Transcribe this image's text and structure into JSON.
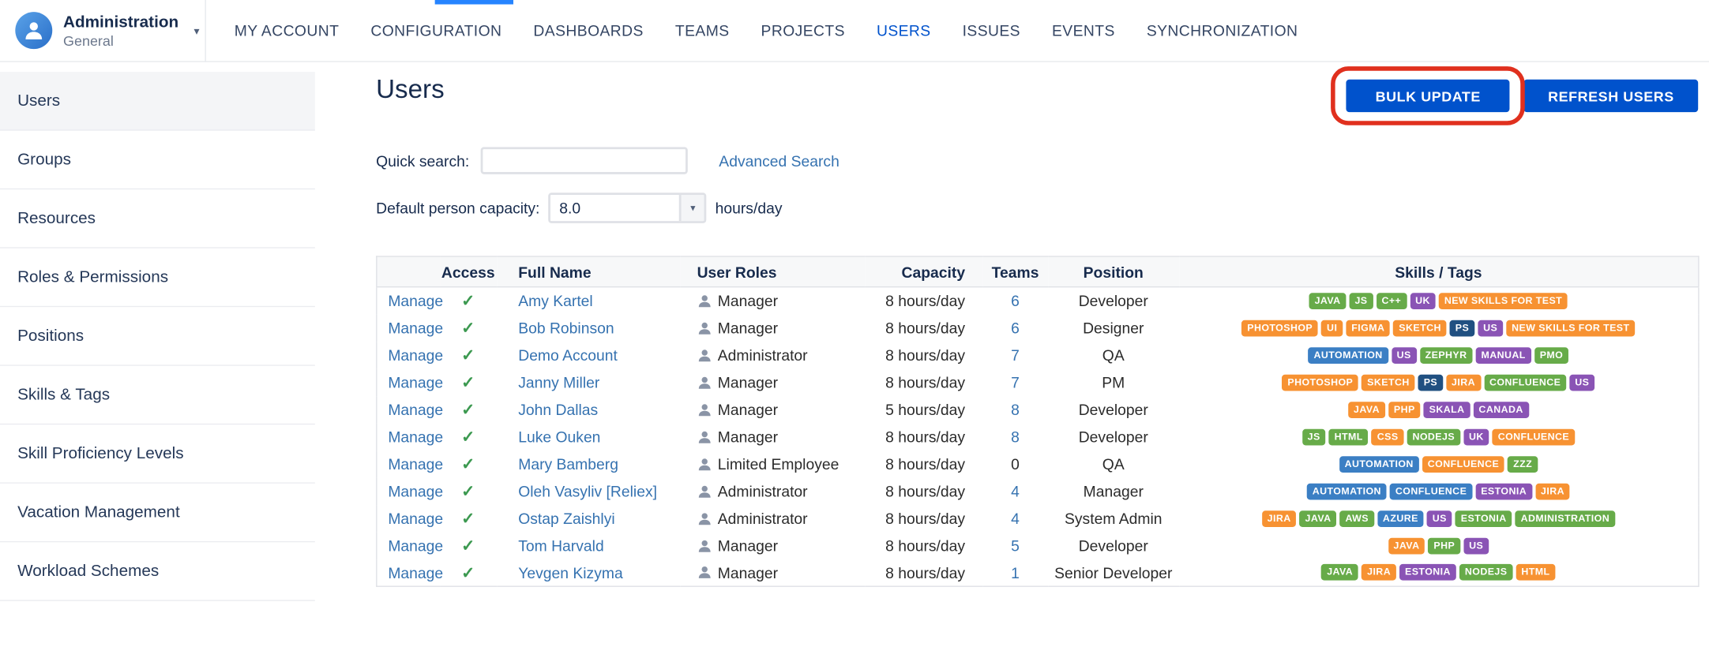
{
  "colors": {
    "accent": "#0052CC",
    "link": "#3572B0",
    "annotation": "#E0301E",
    "check": "#3C9950",
    "icon_gray": "#8A94A6",
    "tags": {
      "green": "#67AB49",
      "orange": "#F79232",
      "purple": "#8A54B5",
      "blue": "#3B7FC4",
      "navy": "#205081"
    }
  },
  "topnav": {
    "title": "Administration",
    "subtitle": "General",
    "items": [
      "MY ACCOUNT",
      "CONFIGURATION",
      "DASHBOARDS",
      "TEAMS",
      "PROJECTS",
      "USERS",
      "ISSUES",
      "EVENTS",
      "SYNCHRONIZATION"
    ],
    "active_item": "USERS",
    "annotated_item": "USERS"
  },
  "sidebar": {
    "items": [
      {
        "label": "Users",
        "selected": true
      },
      {
        "label": "Groups",
        "annotated": true
      },
      {
        "label": "Resources"
      },
      {
        "label": "Roles & Permissions"
      },
      {
        "label": "Positions"
      },
      {
        "label": "Skills & Tags"
      },
      {
        "label": "Skill Proficiency Levels"
      },
      {
        "label": "Vacation Management"
      },
      {
        "label": "Workload Schemes"
      }
    ]
  },
  "main": {
    "title": "Users",
    "quick_search_label": "Quick search:",
    "quick_search_value": "",
    "advanced_search_label": "Advanced Search",
    "capacity_label": "Default person capacity:",
    "capacity_value": "8.0",
    "capacity_unit": "hours/day",
    "buttons": {
      "bulk_update": "BULK UPDATE",
      "refresh_users": "REFRESH USERS"
    }
  },
  "table": {
    "columns": [
      "",
      "Access",
      "Full Name",
      "User Roles",
      "Capacity",
      "Teams",
      "Position",
      "Skills / Tags"
    ],
    "manage_label": "Manage",
    "check_glyph": "✓",
    "rows": [
      {
        "name": "Amy Kartel",
        "role": "Manager",
        "capacity": "8 hours/day",
        "teams": "6",
        "position": "Developer",
        "tags": [
          {
            "t": "JAVA",
            "c": "green"
          },
          {
            "t": "JS",
            "c": "green"
          },
          {
            "t": "C++",
            "c": "green"
          },
          {
            "t": "UK",
            "c": "purple"
          },
          {
            "t": "NEW SKILLS FOR TEST",
            "c": "orange"
          }
        ]
      },
      {
        "name": "Bob Robinson",
        "role": "Manager",
        "capacity": "8 hours/day",
        "teams": "6",
        "position": "Designer",
        "tags": [
          {
            "t": "PHOTOSHOP",
            "c": "orange"
          },
          {
            "t": "UI",
            "c": "orange"
          },
          {
            "t": "FIGMA",
            "c": "orange"
          },
          {
            "t": "SKETCH",
            "c": "orange"
          },
          {
            "t": "PS",
            "c": "navy"
          },
          {
            "t": "US",
            "c": "purple"
          },
          {
            "t": "NEW SKILLS FOR TEST",
            "c": "orange"
          }
        ]
      },
      {
        "name": "Demo Account",
        "role": "Administrator",
        "capacity": "8 hours/day",
        "teams": "7",
        "position": "QA",
        "tags": [
          {
            "t": "AUTOMATION",
            "c": "blue"
          },
          {
            "t": "US",
            "c": "purple"
          },
          {
            "t": "ZEPHYR",
            "c": "green"
          },
          {
            "t": "MANUAL",
            "c": "purple"
          },
          {
            "t": "PMO",
            "c": "green"
          }
        ]
      },
      {
        "name": "Janny Miller",
        "role": "Manager",
        "capacity": "8 hours/day",
        "teams": "7",
        "position": "PM",
        "tags": [
          {
            "t": "PHOTOSHOP",
            "c": "orange"
          },
          {
            "t": "SKETCH",
            "c": "orange"
          },
          {
            "t": "PS",
            "c": "navy"
          },
          {
            "t": "JIRA",
            "c": "orange"
          },
          {
            "t": "CONFLUENCE",
            "c": "green"
          },
          {
            "t": "US",
            "c": "purple"
          }
        ]
      },
      {
        "name": "John Dallas",
        "role": "Manager",
        "capacity": "5 hours/day",
        "teams": "8",
        "position": "Developer",
        "tags": [
          {
            "t": "JAVA",
            "c": "orange"
          },
          {
            "t": "PHP",
            "c": "orange"
          },
          {
            "t": "SKALA",
            "c": "purple"
          },
          {
            "t": "CANADA",
            "c": "purple"
          }
        ]
      },
      {
        "name": "Luke Ouken",
        "role": "Manager",
        "capacity": "8 hours/day",
        "teams": "8",
        "position": "Developer",
        "tags": [
          {
            "t": "JS",
            "c": "green"
          },
          {
            "t": "HTML",
            "c": "green"
          },
          {
            "t": "CSS",
            "c": "orange"
          },
          {
            "t": "NODEJS",
            "c": "green"
          },
          {
            "t": "UK",
            "c": "purple"
          },
          {
            "t": "CONFLUENCE",
            "c": "orange"
          }
        ]
      },
      {
        "name": "Mary Bamberg",
        "role": "Limited Employee",
        "capacity": "8 hours/day",
        "teams": "0",
        "position": "QA",
        "tags": [
          {
            "t": "AUTOMATION",
            "c": "blue"
          },
          {
            "t": "CONFLUENCE",
            "c": "orange"
          },
          {
            "t": "ZZZ",
            "c": "green"
          }
        ]
      },
      {
        "name": "Oleh Vasyliv [Reliex]",
        "role": "Administrator",
        "capacity": "8 hours/day",
        "teams": "4",
        "position": "Manager",
        "tags": [
          {
            "t": "AUTOMATION",
            "c": "blue"
          },
          {
            "t": "CONFLUENCE",
            "c": "blue"
          },
          {
            "t": "ESTONIA",
            "c": "purple"
          },
          {
            "t": "JIRA",
            "c": "orange"
          }
        ]
      },
      {
        "name": "Ostap Zaishlyi",
        "role": "Administrator",
        "capacity": "8 hours/day",
        "teams": "4",
        "position": "System Admin",
        "tags": [
          {
            "t": "JIRA",
            "c": "orange"
          },
          {
            "t": "JAVA",
            "c": "green"
          },
          {
            "t": "AWS",
            "c": "green"
          },
          {
            "t": "AZURE",
            "c": "blue"
          },
          {
            "t": "US",
            "c": "purple"
          },
          {
            "t": "ESTONIA",
            "c": "green"
          },
          {
            "t": "ADMINISTRATION",
            "c": "green"
          }
        ]
      },
      {
        "name": "Tom Harvald",
        "role": "Manager",
        "capacity": "8 hours/day",
        "teams": "5",
        "position": "Developer",
        "tags": [
          {
            "t": "JAVA",
            "c": "orange"
          },
          {
            "t": "PHP",
            "c": "green"
          },
          {
            "t": "US",
            "c": "purple"
          }
        ]
      },
      {
        "name": "Yevgen Kizyma",
        "role": "Manager",
        "capacity": "8 hours/day",
        "teams": "1",
        "position": "Senior Developer",
        "tags": [
          {
            "t": "JAVA",
            "c": "green"
          },
          {
            "t": "JIRA",
            "c": "orange"
          },
          {
            "t": "ESTONIA",
            "c": "purple"
          },
          {
            "t": "NODEJS",
            "c": "green"
          },
          {
            "t": "HTML",
            "c": "orange"
          }
        ]
      }
    ]
  }
}
